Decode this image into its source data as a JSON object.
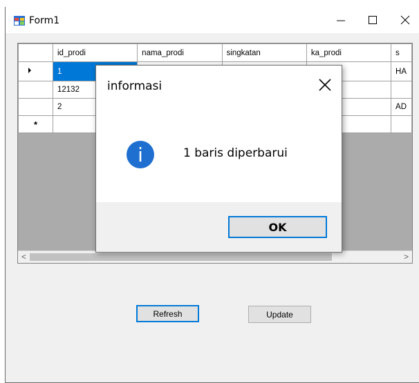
{
  "window": {
    "title": "Form1",
    "icon": "winforms-app-icon",
    "controls": [
      "minimize-icon",
      "maximize-icon",
      "close-icon"
    ]
  },
  "grid": {
    "columns": [
      "id_prodi",
      "nama_prodi",
      "singkatan",
      "ka_prodi",
      "s"
    ],
    "rows": [
      {
        "indicator": "current-row-arrow",
        "cells": [
          "1",
          "",
          "",
          "",
          "HA"
        ],
        "selected_cell": 0
      },
      {
        "indicator": "",
        "cells": [
          "12132",
          "",
          "",
          "",
          ""
        ]
      },
      {
        "indicator": "",
        "cells": [
          "2",
          "",
          "",
          "",
          "AD"
        ]
      },
      {
        "indicator": "new-row-asterisk",
        "cells": [
          "",
          "",
          "",
          "",
          ""
        ]
      }
    ],
    "new_row_marker": "*",
    "scroll_left": "<",
    "scroll_right": ">"
  },
  "buttons": {
    "refresh": "Refresh",
    "update": "Update"
  },
  "dialog": {
    "title": "informasi",
    "message": "1 baris diperbarui",
    "ok": "OK",
    "icon": "info-icon",
    "info_glyph": "i"
  },
  "colors": {
    "accent": "#0078d7",
    "grid_background": "#ababab",
    "window_background": "#f0f0f0"
  }
}
